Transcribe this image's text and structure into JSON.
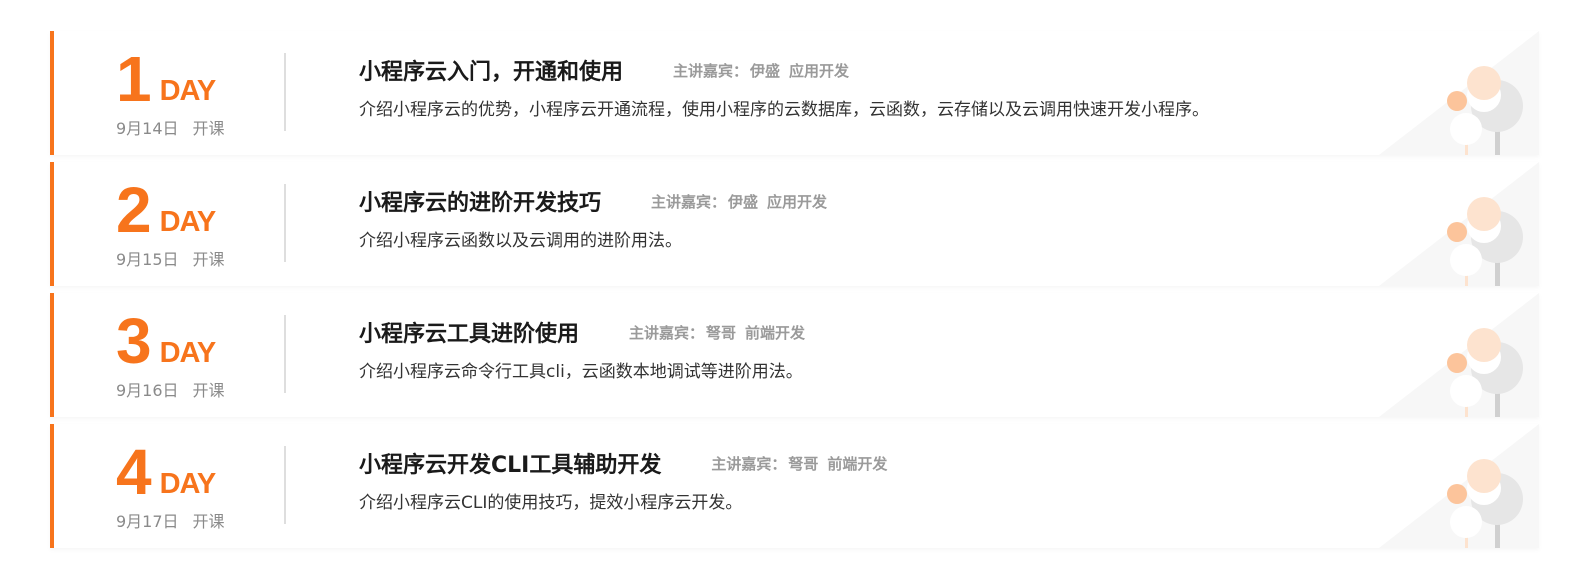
{
  "accent_color": "#f7741c",
  "courses": [
    {
      "day_number": "1",
      "day_word": "DAY",
      "date": "9月14日",
      "kaike": "开课",
      "title": "小程序云入门，开通和使用",
      "speaker_label": "主讲嘉宾：",
      "speaker_name": "伊盛",
      "speaker_role": "应用开发",
      "description": "介绍小程序云的优势，小程序云开通流程，使用小程序的云数据库，云函数，云存储以及云调用快速开发小程序。",
      "decoration_icon": "tree-illustration-icon"
    },
    {
      "day_number": "2",
      "day_word": "DAY",
      "date": "9月15日",
      "kaike": "开课",
      "title": "小程序云的进阶开发技巧",
      "speaker_label": "主讲嘉宾：",
      "speaker_name": "伊盛",
      "speaker_role": "应用开发",
      "description": "介绍小程序云函数以及云调用的进阶用法。",
      "decoration_icon": "tree-illustration-icon"
    },
    {
      "day_number": "3",
      "day_word": "DAY",
      "date": "9月16日",
      "kaike": "开课",
      "title": "小程序云工具进阶使用",
      "speaker_label": "主讲嘉宾：",
      "speaker_name": "弩哥",
      "speaker_role": "前端开发",
      "description": "介绍小程序云命令行工具cli，云函数本地调试等进阶用法。",
      "decoration_icon": "tree-illustration-icon"
    },
    {
      "day_number": "4",
      "day_word": "DAY",
      "date": "9月17日",
      "kaike": "开课",
      "title": "小程序云开发CLI工具辅助开发",
      "speaker_label": "主讲嘉宾：",
      "speaker_name": "弩哥",
      "speaker_role": "前端开发",
      "description": "介绍小程序云CLI的使用技巧，提效小程序云开发。",
      "decoration_icon": "tree-illustration-icon"
    }
  ]
}
